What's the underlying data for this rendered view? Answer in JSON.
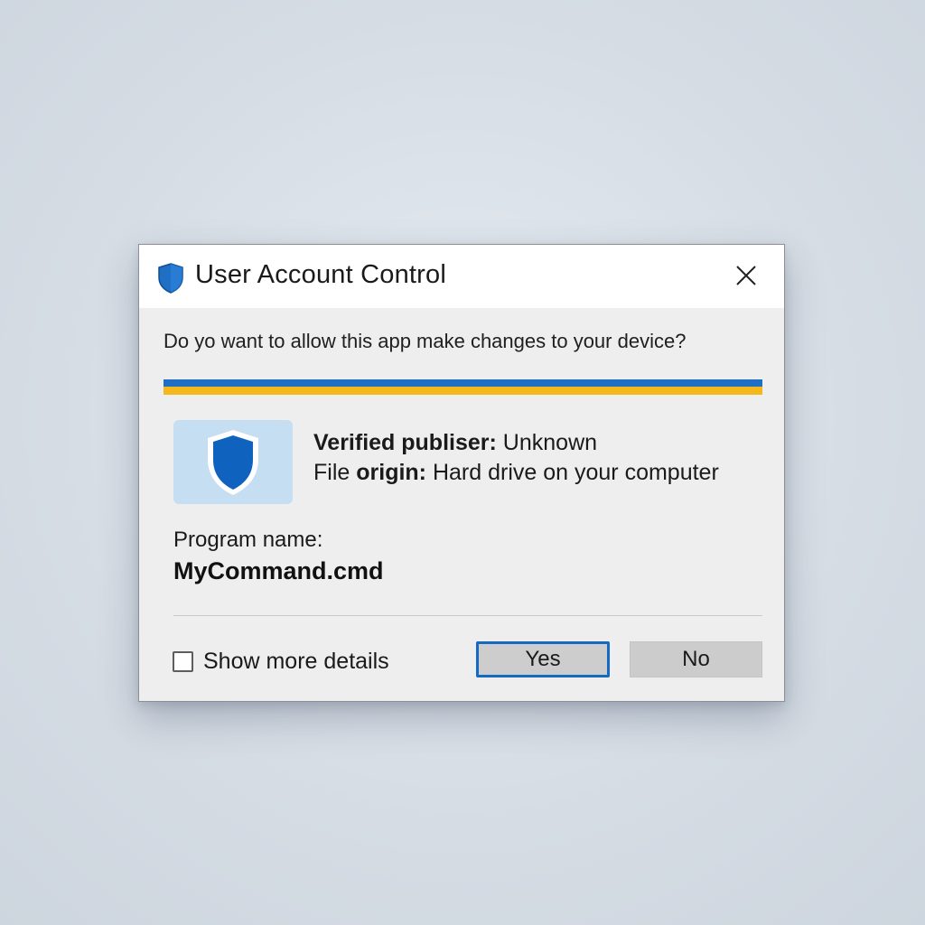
{
  "dialog": {
    "title": "User Account Control",
    "close_icon": "close-icon",
    "title_icon": "shield-icon",
    "question": "Do yo want to allow this app make changes to your device?",
    "banner_colors": {
      "top": "#1f6fc4",
      "bottom": "#f4b81c"
    },
    "app_icon": "shield-icon",
    "publisher": {
      "label": "Verified publiser:",
      "value": "Unknown"
    },
    "origin": {
      "label_prefix": "File",
      "label_bold": "origin:",
      "value": "Hard drive on your computer"
    },
    "program": {
      "label": "Program name:",
      "value": "MyCommand.cmd"
    },
    "details_checkbox": {
      "label": "Show more details",
      "checked": false
    },
    "buttons": {
      "yes": "Yes",
      "no": "No"
    },
    "accent_color": "#1669c2"
  }
}
